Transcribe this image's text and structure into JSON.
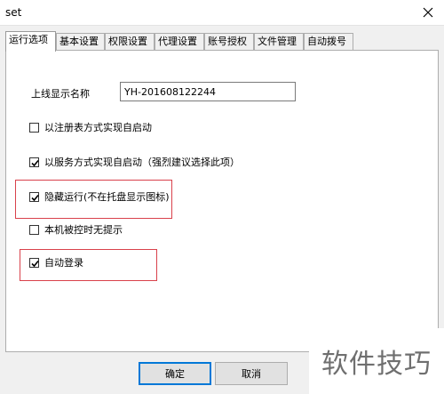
{
  "window": {
    "title": "set"
  },
  "tabs": [
    {
      "label": "运行选项",
      "active": true
    },
    {
      "label": "基本设置",
      "active": false
    },
    {
      "label": "权限设置",
      "active": false
    },
    {
      "label": "代理设置",
      "active": false
    },
    {
      "label": "账号授权",
      "active": false
    },
    {
      "label": "文件管理",
      "active": false
    },
    {
      "label": "自动拨号",
      "active": false
    }
  ],
  "form": {
    "display_name_label": "上线显示名称",
    "display_name_value": "YH-201608122244"
  },
  "options": [
    {
      "label": "以注册表方式实现自启动",
      "checked": false
    },
    {
      "label": "以服务方式实现自启动（强烈建议选择此项）",
      "checked": true
    },
    {
      "label": "隐藏运行(不在托盘显示图标)",
      "checked": true
    },
    {
      "label": "本机被控时无提示",
      "checked": false
    },
    {
      "label": "自动登录",
      "checked": true
    }
  ],
  "buttons": {
    "ok": "确定",
    "cancel": "取消"
  },
  "watermark": "软件技巧",
  "colors": {
    "highlight": "#d9414b",
    "accent": "#0078d7"
  }
}
